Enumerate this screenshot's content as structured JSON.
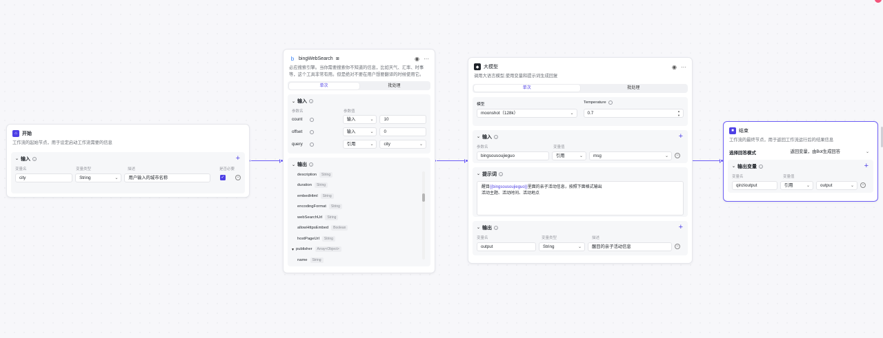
{
  "colors": {
    "accent": "#4e40e5",
    "edge": "#6b5cf5",
    "start_icon": "#4e40e5",
    "end_icon": "#4e40e5",
    "search_icon": "#2f7df6"
  },
  "start": {
    "title": "开始",
    "desc": "工作流的起始节点，用于设定启动工作流需要的信息",
    "input": {
      "label": "输入",
      "cols": [
        "变量名",
        "变量类型",
        "描述",
        "是否必要"
      ],
      "row": {
        "name": "city",
        "type": "String",
        "desc": "用户输入的城市名称",
        "required": true
      }
    }
  },
  "search": {
    "title": "bingWebSearch",
    "desc": "必应搜索引擎。当你需要搜索你不知道的信息，比如天气、汇率、时事等，这个工具非常有用。但是绝对不要在用户想要翻译的时候使用它。",
    "tabs": [
      "单次",
      "批处理"
    ],
    "input": {
      "label": "输入",
      "cols": [
        "参数名",
        "参数值"
      ],
      "rows": [
        {
          "name": "count",
          "mode": "输入",
          "value": "10"
        },
        {
          "name": "offset",
          "mode": "输入",
          "value": "0"
        },
        {
          "name": "query",
          "mode": "引用",
          "value": "city"
        }
      ]
    },
    "output": {
      "label": "输出",
      "items": [
        {
          "name": "description",
          "type": "String"
        },
        {
          "name": "duration",
          "type": "String"
        },
        {
          "name": "embedHtml",
          "type": "String"
        },
        {
          "name": "encodingFormat",
          "type": "String"
        },
        {
          "name": "webSearchUrl",
          "type": "String"
        },
        {
          "name": "allowHttpsEmbed",
          "type": "Boolean"
        },
        {
          "name": "hostPageUrl",
          "type": "String"
        },
        {
          "name": "publisher",
          "type": "Array<Object>"
        },
        {
          "name": "name",
          "type": "String"
        }
      ]
    }
  },
  "llm": {
    "title": "大模型",
    "desc": "调用大语言模型,使用变量和提示词生成回复",
    "tabs": [
      "单次",
      "批处理"
    ],
    "model_label": "模型",
    "model_value": "moonshot（128k）",
    "temp_label": "Temperature",
    "temp_value": "0.7",
    "input": {
      "label": "输入",
      "cols": [
        "参数名",
        "变量值"
      ],
      "row": {
        "name": "bingsousoujieguo",
        "mode": "引用",
        "value": "msg"
      }
    },
    "prompt": {
      "label": "提示词",
      "line1_pre": "醒目",
      "line1_var": "{{bingsousoujieguo}}",
      "line1_post": "里面的亲子活动信息，按照下面格式输出",
      "line2": "活动主题、活动时间、活动地点"
    },
    "output": {
      "label": "输出",
      "cols": [
        "变量名",
        "变量类型",
        "描述"
      ],
      "row": {
        "name": "output",
        "type": "String",
        "desc": "醒目的亲子活动信息"
      }
    }
  },
  "end": {
    "title": "结束",
    "desc": "工作流的最终节点，用于返回工作流运行后的结果信息",
    "mode_label": "选择回答模式",
    "mode_value": "返回变量，由Bot生成回答",
    "output": {
      "label": "输出变量",
      "cols": [
        "变量名",
        "变量值"
      ],
      "row": {
        "name": "qinzioutput",
        "mode": "引用",
        "value": "output"
      }
    }
  }
}
